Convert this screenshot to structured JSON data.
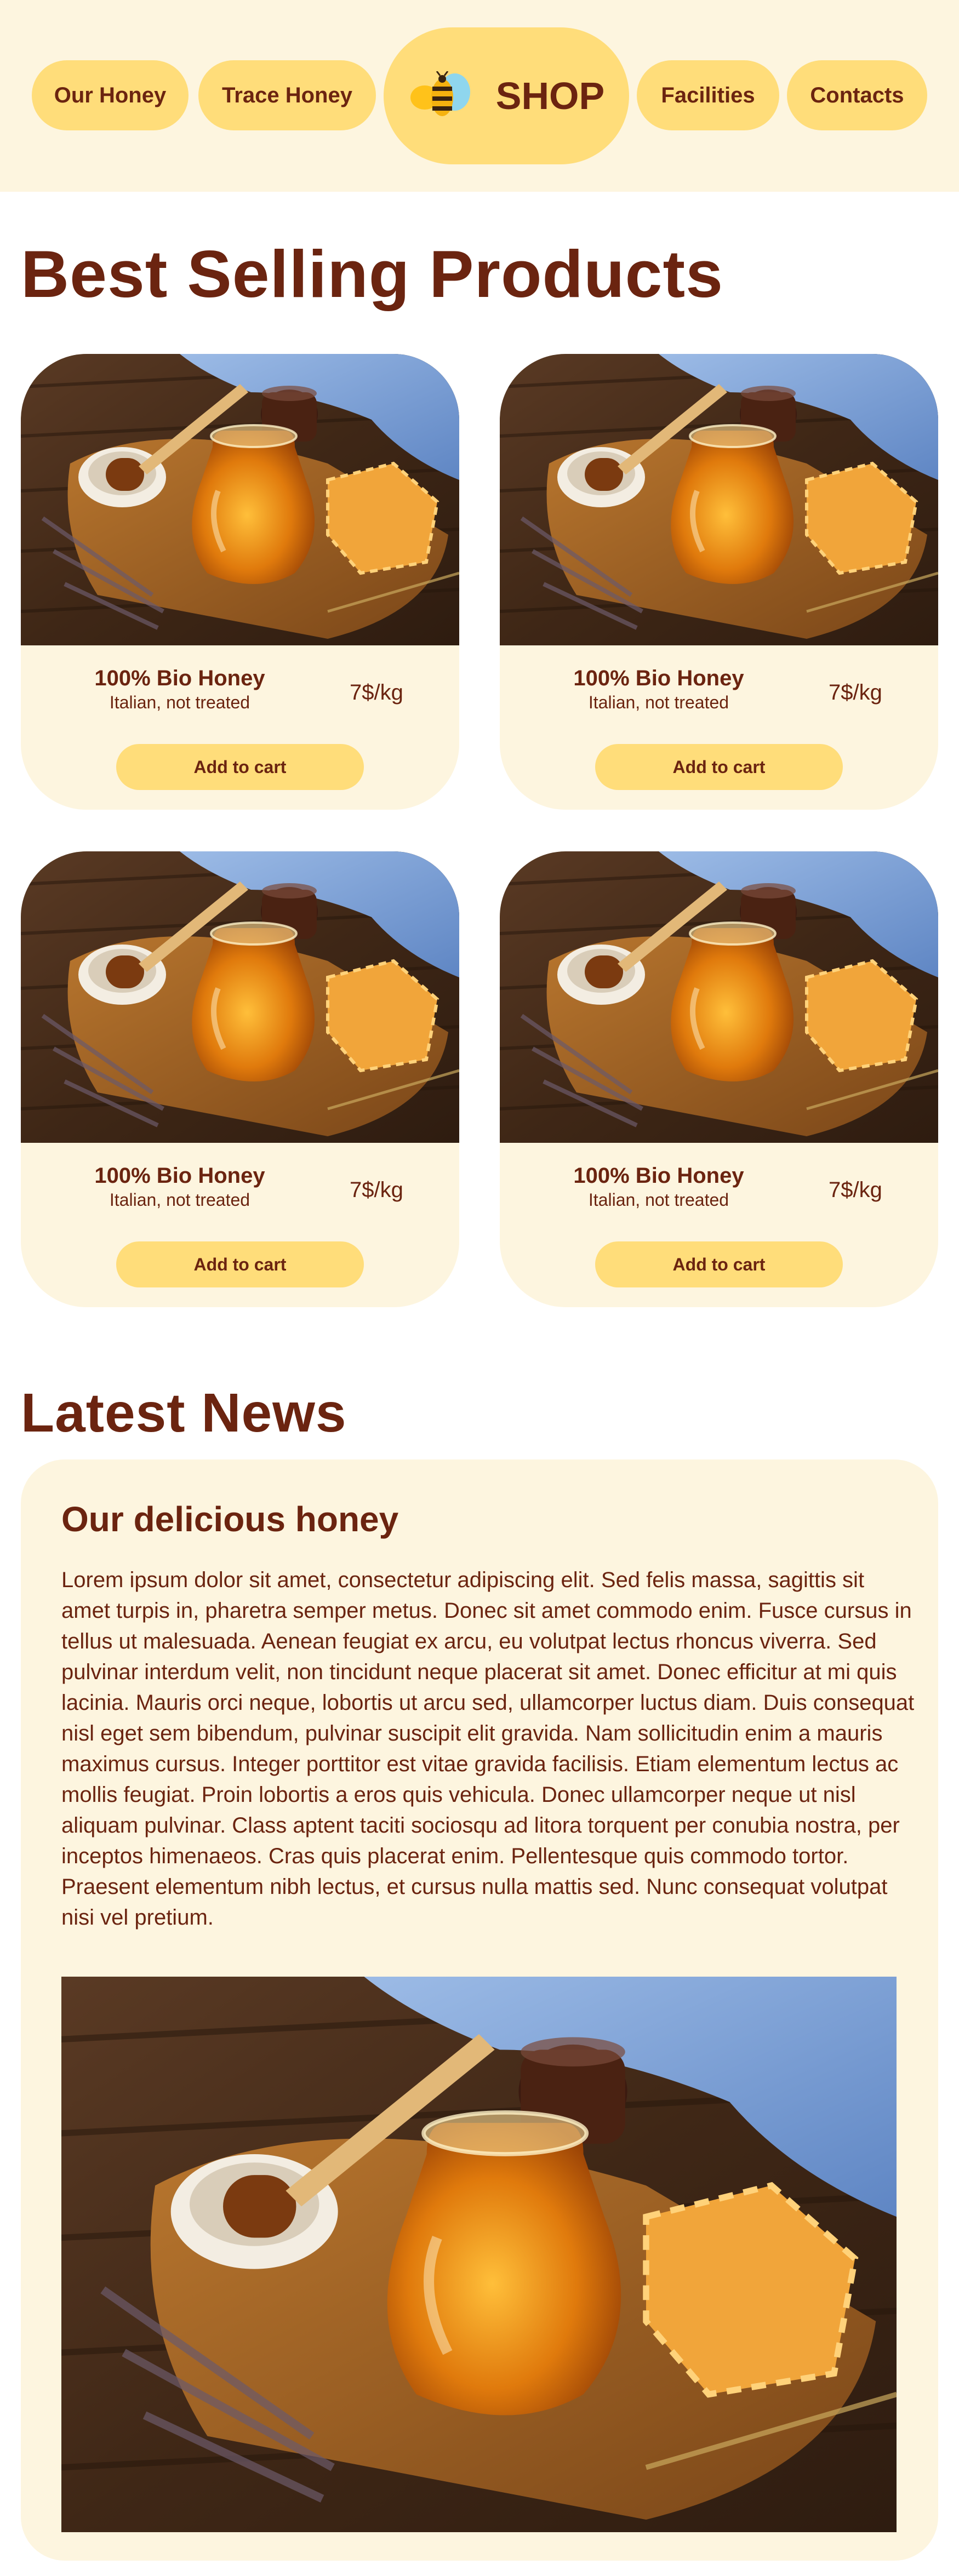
{
  "nav": {
    "left_items": [
      "Our Honey",
      "Trace Honey"
    ],
    "shop_label": "SHOP",
    "right_items": [
      "Facilities",
      "Contacts"
    ]
  },
  "products_section": {
    "title": "Best Selling Products",
    "products": [
      {
        "name": "100% Bio Honey",
        "description": "Italian, not treated",
        "price": "7$/kg",
        "button": "Add to cart"
      },
      {
        "name": "100% Bio Honey",
        "description": "Italian, not treated",
        "price": "7$/kg",
        "button": "Add to cart"
      },
      {
        "name": "100% Bio Honey",
        "description": "Italian, not treated",
        "price": "7$/kg",
        "button": "Add to cart"
      },
      {
        "name": "100% Bio Honey",
        "description": "Italian, not treated",
        "price": "7$/kg",
        "button": "Add to cart"
      }
    ]
  },
  "news_section": {
    "title": "Latest News",
    "article": {
      "title": "Our delicious honey",
      "body": "Lorem ipsum dolor sit amet, consectetur adipiscing elit. Sed felis massa, sagittis sit amet turpis in, pharetra semper metus. Donec sit amet commodo enim. Fusce cursus in tellus ut malesuada. Aenean feugiat ex arcu, eu volutpat lectus rhoncus viverra. Sed pulvinar interdum velit, non tincidunt neque placerat sit amet. Donec efficitur at mi quis lacinia. Mauris orci neque, lobortis ut arcu sed, ullamcorper luctus diam. Duis consequat nisl eget sem bibendum, pulvinar suscipit elit gravida. Nam sollicitudin enim a mauris maximus cursus. Integer porttitor est vitae gravida facilisis. Etiam elementum lectus ac mollis feugiat. Proin lobortis a eros quis vehicula. Donec ullamcorper neque ut nisl aliquam pulvinar. Class aptent taciti sociosqu ad litora torquent per conubia nostra, per inceptos himenaeos. Cras quis placerat enim. Pellentesque quis commodo tortor. Praesent elementum nibh lectus, et cursus nulla mattis sed. Nunc consequat volutpat nisi vel pretium."
    }
  },
  "colors": {
    "header_bg": "#fdf5df",
    "accent": "#ffdd7a",
    "text": "#6b2410"
  }
}
